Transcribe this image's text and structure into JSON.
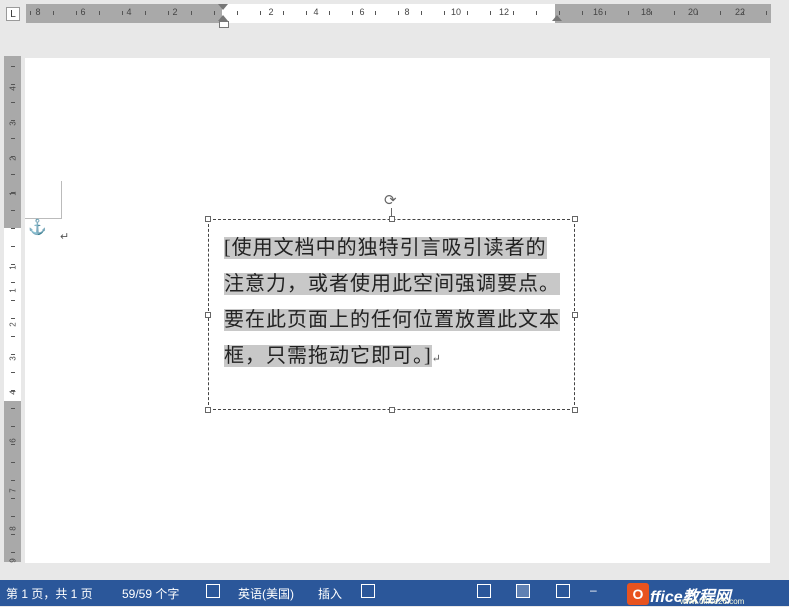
{
  "ruler": {
    "tab_selector": "L",
    "h_labels": [
      "8",
      "6",
      "4",
      "2",
      "2",
      "4",
      "6",
      "8",
      "10",
      "12",
      "16",
      "18",
      "20",
      "22"
    ],
    "v_labels": [
      "4",
      "3",
      "2",
      "1",
      "1",
      "1",
      "2",
      "3",
      "4",
      "6",
      "7",
      "8",
      "9"
    ]
  },
  "document": {
    "textbox_text": "[使用文档中的独特引言吸引读者的注意力，或者使用此空间强调要点。要在此页面上的任何位置放置此文本框，只需拖动它即可。]",
    "paragraph_mark": "↵"
  },
  "status": {
    "page_info": "第 1 页，共 1 页",
    "word_count": "59/59 个字",
    "language": "英语(美国)",
    "mode": "插入"
  },
  "watermark": {
    "logo": "O",
    "text": "ffice教程网",
    "url": "www.office26.com"
  },
  "colors": {
    "statusbar": "#2b579a",
    "highlight": "#c8c8c8",
    "anchor": "#2f5d9a"
  }
}
